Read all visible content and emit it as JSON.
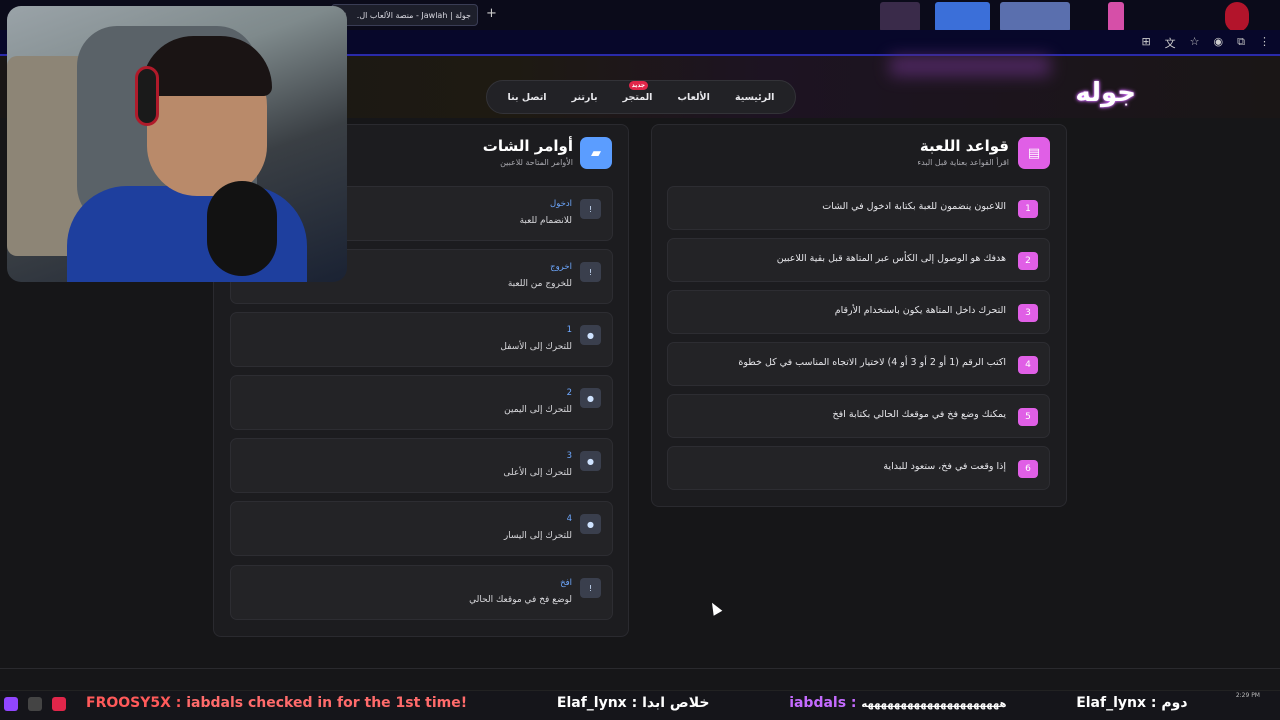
{
  "browser": {
    "tab_title": "جولة | Jawlah - منصة الألعاب ال...",
    "new_tab": "+",
    "close": "×"
  },
  "site": {
    "logo": "جوله",
    "nav": [
      {
        "label": "الرئيسية"
      },
      {
        "label": "الألعاب"
      },
      {
        "label": "المتجر",
        "badge": "جديد"
      },
      {
        "label": "بارتنر"
      },
      {
        "label": "اتصل بنا"
      }
    ]
  },
  "rules_panel": {
    "title": "قواعد اللعبة",
    "subtitle": "اقرأ القواعد بعناية قبل البدء",
    "rules": [
      {
        "num": "1",
        "text": "اللاعبون ينضمون للعبة بكتابة ادخول في الشات"
      },
      {
        "num": "2",
        "text": "هدفك هو الوصول إلى الكأس عبر المتاهة قبل بقية اللاعبين"
      },
      {
        "num": "3",
        "text": "التحرك داخل المتاهة يكون باستخدام الأرقام"
      },
      {
        "num": "4",
        "text": "اكتب الرقم (1 أو 2 أو 3 أو 4) لاختيار الاتجاه المناسب في كل خطوة"
      },
      {
        "num": "5",
        "text": "يمكنك وضع فخ في موقعك الحالي بكتابة افخ"
      },
      {
        "num": "6",
        "text": "إذا وقعت في فخ، ستعود للبداية"
      }
    ]
  },
  "commands_panel": {
    "title": "أوامر الشات",
    "subtitle": "الأوامر المتاحة للاعبين",
    "commands": [
      {
        "icon": "!",
        "name": "ادخول",
        "desc": "للانضمام للعبة"
      },
      {
        "icon": "!",
        "name": "اخروج",
        "desc": "للخروج من اللعبة"
      },
      {
        "icon": "chat",
        "name": "1",
        "desc": "للتحرك إلى الأسفل"
      },
      {
        "icon": "chat",
        "name": "2",
        "desc": "للتحرك إلى اليمين"
      },
      {
        "icon": "chat",
        "name": "3",
        "desc": "للتحرك إلى الأعلى"
      },
      {
        "icon": "chat",
        "name": "4",
        "desc": "للتحرك إلى اليسار"
      },
      {
        "icon": "!",
        "name": "افخ",
        "desc": "لوضع فخ في موقعك الحالي"
      }
    ]
  },
  "ticker": {
    "user1": "FROOSY5X :",
    "msg1": "iabdals checked in for the 1st time!",
    "user2": "Elaf_lynx :",
    "msg2": "خلاص ابدا",
    "user3": "iabdals :",
    "msg3": "هههههههههههههههههههههه",
    "user4": "Elaf_lynx :",
    "msg4": "دوم"
  },
  "clock": "2:29 PM",
  "colors": {
    "accent_pink": "#e05fe6",
    "accent_blue": "#6ea8ff",
    "badge_red": "#e0264a",
    "panel_bg": "#1c1c1f"
  }
}
